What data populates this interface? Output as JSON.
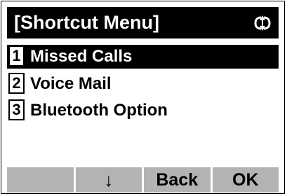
{
  "title": "[Shortcut Menu]",
  "nav_icon": "up-down-arrow-icon",
  "menu": [
    {
      "number": "1",
      "label": "Missed Calls",
      "selected": true
    },
    {
      "number": "2",
      "label": "Voice Mail",
      "selected": false
    },
    {
      "number": "3",
      "label": "Bluetooth Option",
      "selected": false
    }
  ],
  "softkeys": [
    "",
    "↓",
    "Back",
    "OK"
  ]
}
